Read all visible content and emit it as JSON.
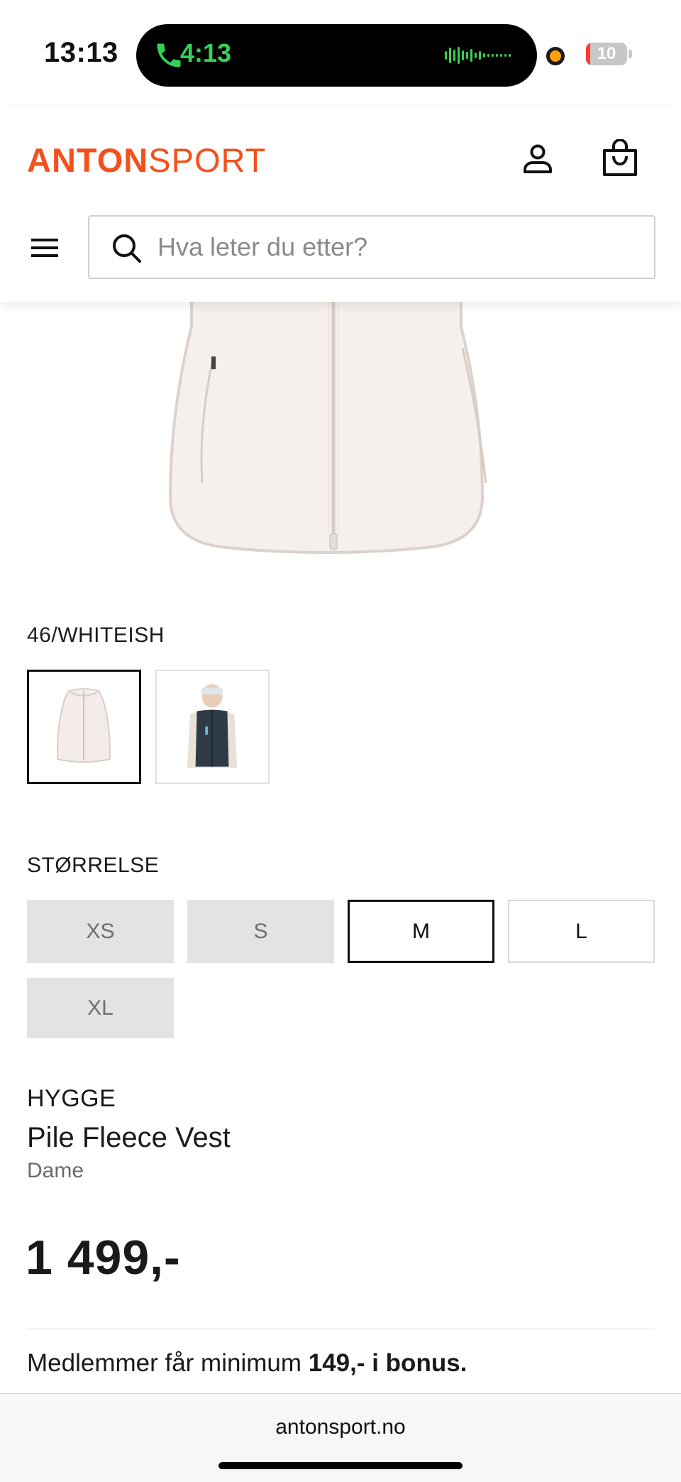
{
  "status_bar": {
    "time": "13:13",
    "call_time": "4:13",
    "battery_level": "10",
    "battery_fraction": 0.1
  },
  "header": {
    "logo_bold": "ANTON",
    "logo_light": "SPORT",
    "brand_color": "#f4501c",
    "icons": [
      "account-icon",
      "shopping-bag-icon",
      "menu-icon",
      "search-icon"
    ]
  },
  "search": {
    "placeholder": "Hva leter du etter?"
  },
  "product": {
    "color_label": "46/WHITEISH",
    "swatches": [
      {
        "name": "whiteish",
        "selected": true
      },
      {
        "name": "model-dark",
        "selected": false
      }
    ],
    "size_label": "STØRRELSE",
    "sizes": [
      {
        "label": "XS",
        "state": "unavailable"
      },
      {
        "label": "S",
        "state": "unavailable"
      },
      {
        "label": "M",
        "state": "selected"
      },
      {
        "label": "L",
        "state": "available"
      },
      {
        "label": "XL",
        "state": "unavailable"
      }
    ],
    "brand": "HYGGE",
    "name": "Pile Fleece Vest",
    "gender": "Dame",
    "price": "1 499,-",
    "bonus_prefix": "Medlemmer får minimum ",
    "bonus_bold": "149,- i bonus."
  },
  "browser": {
    "url": "antonsport.no"
  }
}
